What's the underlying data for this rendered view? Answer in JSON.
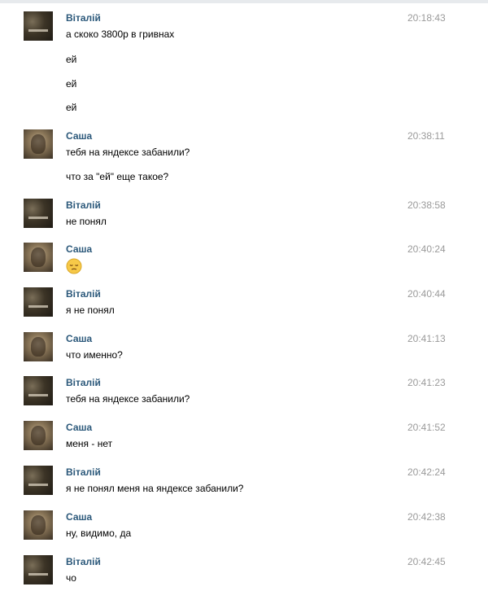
{
  "messages": [
    {
      "sender": "Віталій",
      "time": "20:18:43",
      "avatar": "avatar-vitaliy",
      "lines": [
        "а скоко 3800р в гривнах",
        "ей",
        "ей",
        "ей"
      ]
    },
    {
      "sender": "Саша",
      "time": "20:38:11",
      "avatar": "avatar-sasha",
      "lines": [
        "тебя на яндексе забанили?",
        "что за \"ей\" еще такое?"
      ]
    },
    {
      "sender": "Віталій",
      "time": "20:38:58",
      "avatar": "avatar-vitaliy",
      "lines": [
        "не понял"
      ]
    },
    {
      "sender": "Саша",
      "time": "20:40:24",
      "avatar": "avatar-sasha",
      "emoji": "pensive-face-emoji"
    },
    {
      "sender": "Віталій",
      "time": "20:40:44",
      "avatar": "avatar-vitaliy",
      "lines": [
        "я не понял"
      ]
    },
    {
      "sender": "Саша",
      "time": "20:41:13",
      "avatar": "avatar-sasha",
      "lines": [
        "что именно?"
      ]
    },
    {
      "sender": "Віталій",
      "time": "20:41:23",
      "avatar": "avatar-vitaliy",
      "lines": [
        "тебя на яндексе забанили?"
      ]
    },
    {
      "sender": "Саша",
      "time": "20:41:52",
      "avatar": "avatar-sasha",
      "lines": [
        "меня - нет"
      ]
    },
    {
      "sender": "Віталій",
      "time": "20:42:24",
      "avatar": "avatar-vitaliy",
      "lines": [
        "я не понял меня на яндексе забанили?"
      ]
    },
    {
      "sender": "Саша",
      "time": "20:42:38",
      "avatar": "avatar-sasha",
      "lines": [
        "ну, видимо, да"
      ]
    },
    {
      "sender": "Віталій",
      "time": "20:42:45",
      "avatar": "avatar-vitaliy",
      "lines": [
        "чо"
      ]
    }
  ]
}
